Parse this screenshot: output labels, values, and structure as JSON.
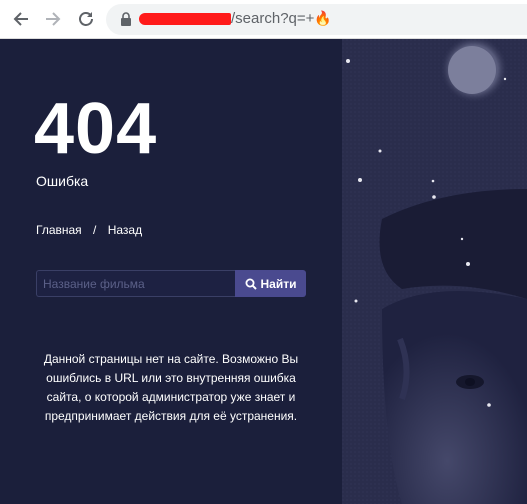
{
  "browser": {
    "url_suffix": "/search?q=+",
    "url_emoji": "🔥"
  },
  "error": {
    "code": "404",
    "label": "Ошибка"
  },
  "breadcrumbs": {
    "home": "Главная",
    "separator": "/",
    "back": "Назад"
  },
  "search": {
    "placeholder": "Название фильма",
    "button_label": "Найти"
  },
  "message": "Данной страницы нет на сайте. Возможно Вы ошиблись в URL или это внутренняя ошибка сайта, о которой администратор уже знает и предпринимает действия для её устранения.",
  "colors": {
    "background": "#1b1f3b",
    "button": "#4a4a8f",
    "redaction": "#ff1a1a"
  }
}
